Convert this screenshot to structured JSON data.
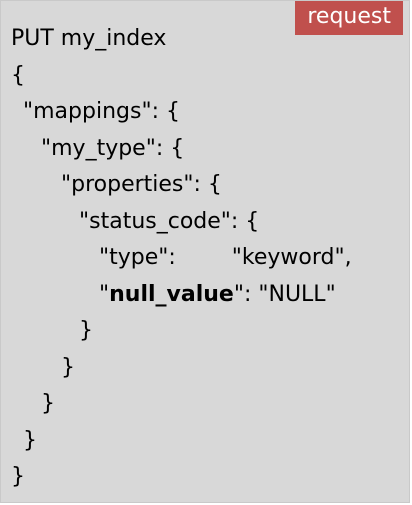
{
  "badge": {
    "label": "request"
  },
  "code": {
    "request_line": "PUT my_index",
    "brace_open": "{",
    "mappings_line": "\"mappings\": {",
    "my_type_line": "\"my_type\": {",
    "properties_line": "\"properties\": {",
    "status_code_line": "\"status_code\": {",
    "type_key": "\"type\":",
    "type_value": "\"keyword\",",
    "null_value_key": "null_value",
    "null_value_rest": ": \"NULL\"",
    "quote": "\"",
    "close_4": "}",
    "close_3": "}",
    "close_2": "}",
    "close_1": "}",
    "close_0": "}"
  },
  "colors": {
    "panel_background": "#d8d8d8",
    "badge_background": "#c0504d",
    "badge_text": "#ffffff",
    "code_text": "#000000"
  }
}
